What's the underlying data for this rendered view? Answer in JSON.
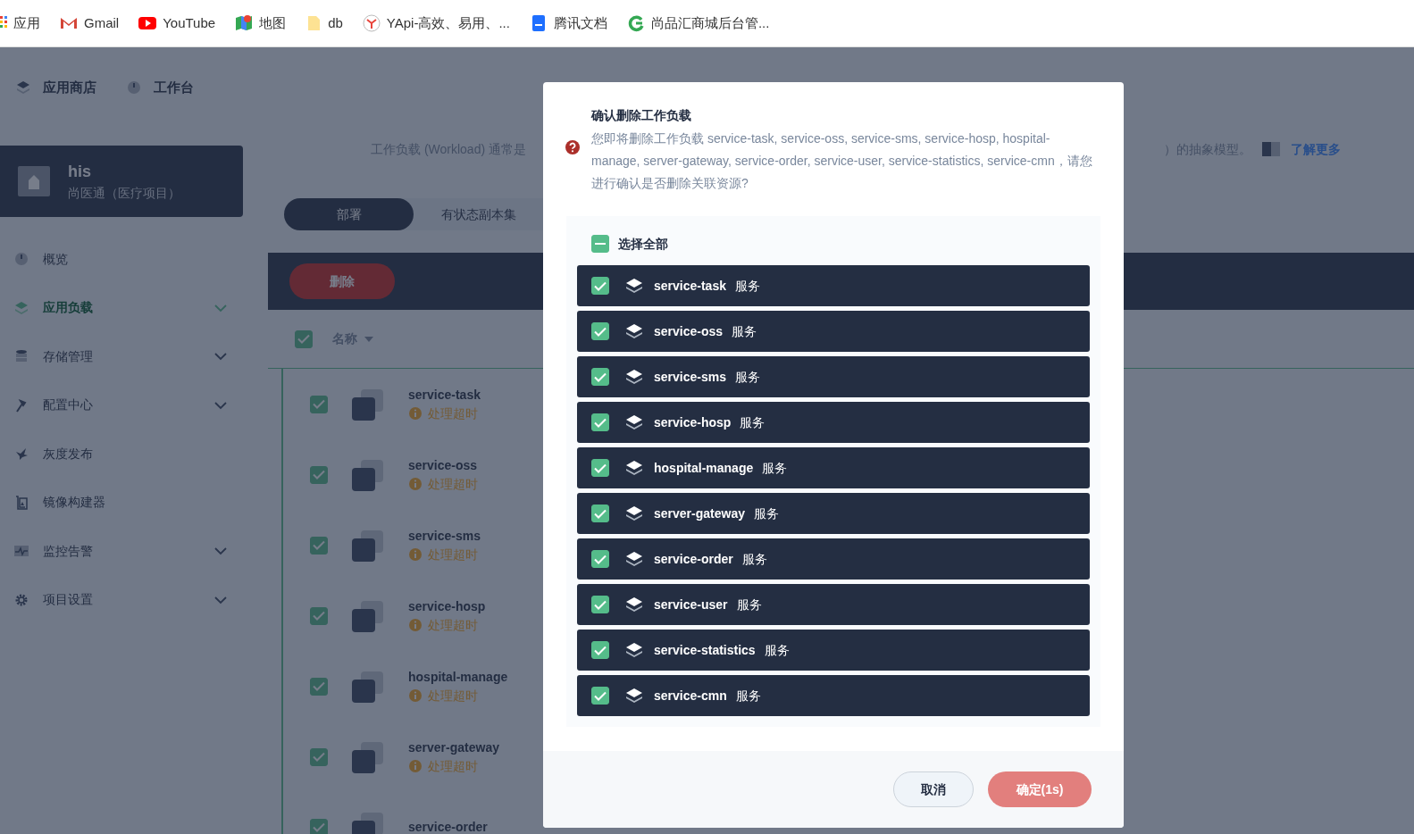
{
  "bookmarks": [
    {
      "label": "应用",
      "kind": "apps"
    },
    {
      "label": "Gmail",
      "kind": "mail"
    },
    {
      "label": "YouTube",
      "kind": "video"
    },
    {
      "label": "地图",
      "kind": "map"
    },
    {
      "label": "db",
      "kind": "folder"
    },
    {
      "label": "YApi-高效、易用、...",
      "kind": "yapi"
    },
    {
      "label": "腾讯文档",
      "kind": "doc"
    },
    {
      "label": "尚品汇商城后台管...",
      "kind": "cycle"
    }
  ],
  "top_nav": [
    {
      "label": "应用商店",
      "kind": "layers"
    },
    {
      "label": "工作台",
      "kind": "gauge"
    }
  ],
  "project": {
    "name": "his",
    "description": "尚医通（医疗项目）"
  },
  "sidebar": {
    "items": [
      {
        "label": "概览",
        "kind": "gauge",
        "expandable": false,
        "selected": false
      },
      {
        "label": "应用负载",
        "kind": "layers",
        "expandable": true,
        "selected": true
      },
      {
        "label": "存储管理",
        "kind": "database",
        "expandable": true,
        "selected": false
      },
      {
        "label": "配置中心",
        "kind": "hammer",
        "expandable": true,
        "selected": false
      },
      {
        "label": "灰度发布",
        "kind": "bird",
        "expandable": false,
        "selected": false
      },
      {
        "label": "镜像构建器",
        "kind": "image",
        "expandable": false,
        "selected": false
      },
      {
        "label": "监控告警",
        "kind": "pulse",
        "expandable": true,
        "selected": false
      },
      {
        "label": "项目设置",
        "kind": "gear",
        "expandable": true,
        "selected": false
      }
    ]
  },
  "page": {
    "description": "工作负载 (Workload) 通常是",
    "description_end": "）的抽象模型。",
    "learn_more": "了解更多",
    "tabs": [
      {
        "label": "部署",
        "selected": true
      },
      {
        "label": "有状态副本集",
        "selected": false
      }
    ],
    "delete_button": "删除",
    "table": {
      "columns": [
        "名称"
      ],
      "header_checked": true,
      "rows": [
        {
          "name": "service-task",
          "status": "处理超时",
          "checked": true
        },
        {
          "name": "service-oss",
          "status": "处理超时",
          "checked": true
        },
        {
          "name": "service-sms",
          "status": "处理超时",
          "checked": true
        },
        {
          "name": "service-hosp",
          "status": "处理超时",
          "checked": true
        },
        {
          "name": "hospital-manage",
          "status": "处理超时",
          "checked": true
        },
        {
          "name": "server-gateway",
          "status": "处理超时",
          "checked": true
        },
        {
          "name": "service-order",
          "checked": true
        }
      ]
    }
  },
  "dialog": {
    "title": "确认删除工作负载",
    "message": "您即将删除工作负载 service-task, service-oss, service-sms, service-hosp, hospital-manage, server-gateway, service-order, service-user, service-statistics, service-cmn，请您进行确认是否删除关联资源?",
    "select_all": {
      "label": "选择全部",
      "indeterminate": true
    },
    "items": [
      {
        "name": "service-task",
        "type": "服务",
        "checked": true
      },
      {
        "name": "service-oss",
        "type": "服务",
        "checked": true
      },
      {
        "name": "service-sms",
        "type": "服务",
        "checked": true
      },
      {
        "name": "service-hosp",
        "type": "服务",
        "checked": true
      },
      {
        "name": "hospital-manage",
        "type": "服务",
        "checked": true
      },
      {
        "name": "server-gateway",
        "type": "服务",
        "checked": true
      },
      {
        "name": "service-order",
        "type": "服务",
        "checked": true
      },
      {
        "name": "service-user",
        "type": "服务",
        "checked": true
      },
      {
        "name": "service-statistics",
        "type": "服务",
        "checked": true
      },
      {
        "name": "service-cmn",
        "type": "服务",
        "checked": true
      }
    ],
    "cancel_button": "取消",
    "confirm_button": "确定(1s)"
  }
}
